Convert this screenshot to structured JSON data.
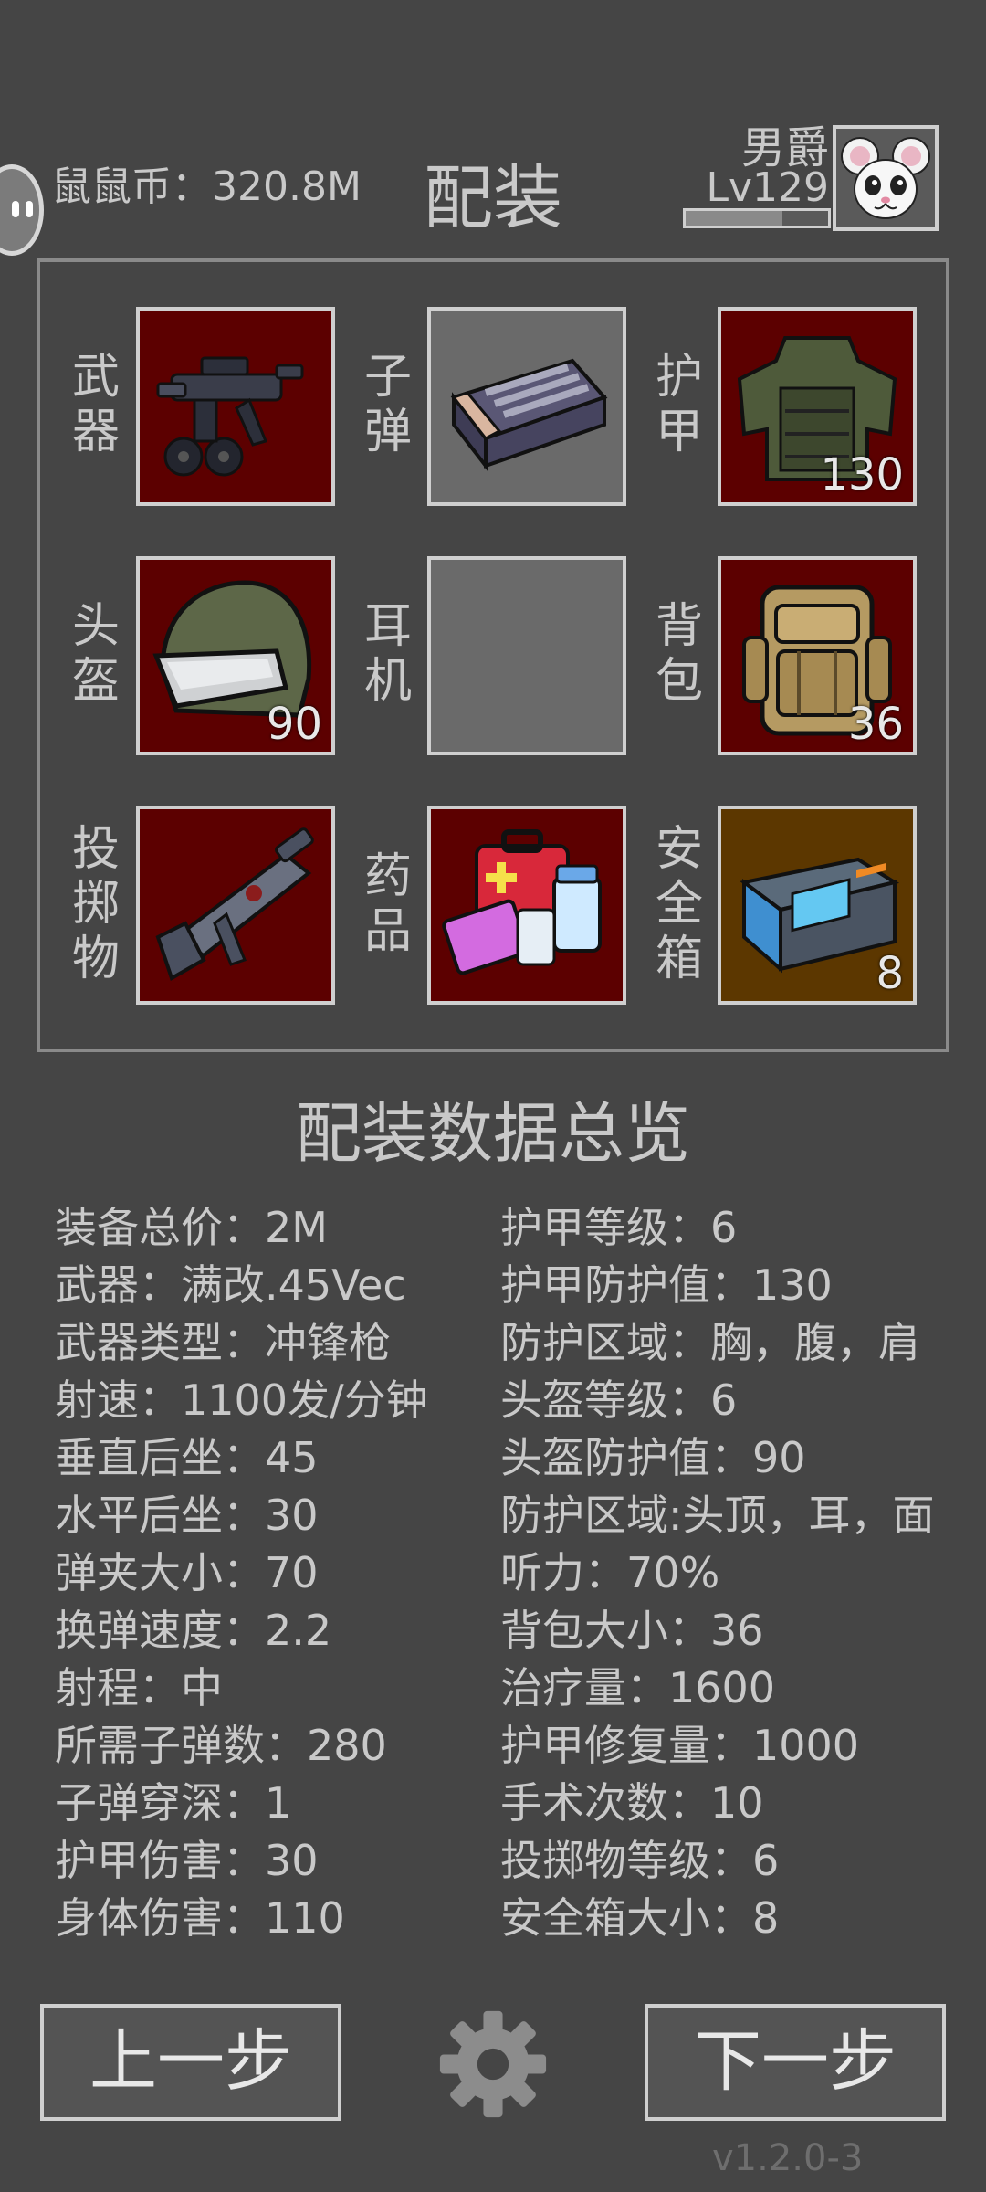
{
  "header": {
    "coins_label": "鼠鼠币：320.8M",
    "title": "配装",
    "rank": "男爵",
    "level": "Lv129",
    "xp_progress": 0.68
  },
  "slots": [
    {
      "label": "武器",
      "icon": "smg-icon",
      "count": ""
    },
    {
      "label": "子弹",
      "icon": "ammo-box-icon",
      "count": ""
    },
    {
      "label": "护甲",
      "icon": "body-armor-icon",
      "count": "130"
    },
    {
      "label": "头盔",
      "icon": "helmet-icon",
      "count": "90"
    },
    {
      "label": "耳机",
      "icon": "",
      "count": ""
    },
    {
      "label": "背包",
      "icon": "backpack-icon",
      "count": "36"
    },
    {
      "label": "投掷物",
      "icon": "grenade-launcher-icon",
      "count": ""
    },
    {
      "label": "药品",
      "icon": "medkit-icon",
      "count": ""
    },
    {
      "label": "安全箱",
      "icon": "secure-case-icon",
      "count": "8"
    }
  ],
  "summary": {
    "title": "配装数据总览",
    "left": [
      "装备总价：2M",
      "武器：满改.45Vec",
      "武器类型：冲锋枪",
      "射速：1100发/分钟",
      "垂直后坐：45",
      "水平后坐：30",
      "弹夹大小：70",
      "换弹速度：2.2",
      "射程：中",
      "所需子弹数：280",
      "子弹穿深：1",
      "护甲伤害：30",
      "身体伤害：110"
    ],
    "right": [
      "护甲等级：6",
      "护甲防护值：130",
      "防护区域：胸，腹，肩",
      "头盔等级：6",
      "头盔防护值：90",
      "防护区域:头顶，耳，面",
      "听力：70%",
      "背包大小：36",
      "治疗量：1600",
      "护甲修复量：1000",
      "手术次数：10",
      "投掷物等级：6",
      "安全箱大小：8"
    ]
  },
  "footer": {
    "prev_label": "上一步",
    "next_label": "下一步",
    "version": "v1.2.0-3"
  }
}
